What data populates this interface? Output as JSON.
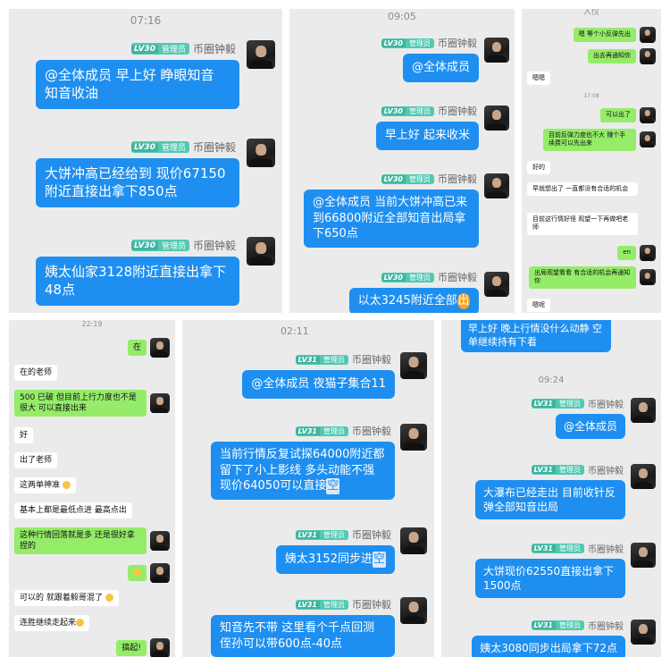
{
  "panelA": {
    "time": "07:16",
    "badge_lv": "LV30",
    "badge_role": "管理员",
    "name": "币圈钟毅",
    "messages": [
      "@全体成员 早上好 睁眼知音 知音收油",
      "大饼冲高已经给到 现价67150附近直接出拿下850点",
      "姨太仙家3128附近直接出拿下48点"
    ]
  },
  "panelB": {
    "time": "09:05",
    "badge_lv": "LV30",
    "badge_role": "管理员",
    "name": "币圈钟毅",
    "messages": [
      "@全体成员",
      "早上好 起来收米",
      "@全体成员 当前大饼冲高已来到66800附近全部知音出局拿下650点",
      "以太3245附近全部",
      "出"
    ]
  },
  "panelC": {
    "top_text": "入仪",
    "time": "17:08",
    "chat": [
      {
        "side": "right",
        "text": "嗯 等个小反弹先出"
      },
      {
        "side": "right",
        "text": "出去再通知你"
      },
      {
        "side": "left",
        "text": "嗯嗯"
      },
      {
        "side": "right",
        "text": "可以出了"
      },
      {
        "side": "right",
        "text": "目前反弹力度也不大 赚个手续费可以先出来"
      },
      {
        "side": "left",
        "text": "好的"
      },
      {
        "side": "left",
        "text": "早就想出了 一直都没有合适的机会"
      },
      {
        "side": "left",
        "text": "目前这行情好怪 观望一下再做吧老师"
      },
      {
        "side": "right",
        "text": "en"
      },
      {
        "side": "right",
        "text": "出局观望看看 有合适的机会再通知你"
      },
      {
        "side": "left",
        "text": "嗯呢"
      }
    ]
  },
  "panelD": {
    "time": "22:19",
    "chat": [
      {
        "side": "right",
        "text": "在"
      },
      {
        "side": "left",
        "text": "在的老师"
      },
      {
        "side": "right",
        "text": "500 已破 但目前上行力度也不是很大 可以直接出来"
      },
      {
        "side": "left",
        "text": "好"
      },
      {
        "side": "left",
        "text": "出了老师"
      },
      {
        "side": "left",
        "text": "这两单神准"
      },
      {
        "side": "left",
        "text": "基本上都是最低点进 最高点出"
      },
      {
        "side": "right",
        "text": "这种行情回落就是多 还是很好拿捏的"
      },
      {
        "side": "right",
        "text": ""
      },
      {
        "side": "left",
        "text": "可以的 就跟着毅哥混了"
      },
      {
        "side": "left",
        "text": "连胜继续走起来"
      },
      {
        "side": "right",
        "text": "搞起!"
      }
    ]
  },
  "panelE": {
    "time": "02:11",
    "badge_lv": "LV31",
    "badge_role": "管理员",
    "name": "币圈钟毅",
    "messages": [
      "@全体成员 夜猫子集合11",
      "当前行情反复试探64000附近都留下了小上影线 多头动能不强现价64050可以直接",
      "空",
      "姨太3152同步进",
      "空",
      "知音先不带 这里看个千点回测侄孙可以带600点-40点"
    ]
  },
  "panelF": {
    "top_message": "早上好 晚上行情没什么动静 空单继续持有下看",
    "time": "09:24",
    "badge_lv": "LV31",
    "badge_role": "管理员",
    "name": "币圈钟毅",
    "messages": [
      "@全体成员",
      "大瀑布已经走出 目前收针反弹全部知音出局",
      "大饼现价62550直接出拿下1500点",
      "姨太3080同步出局拿下72点"
    ]
  }
}
